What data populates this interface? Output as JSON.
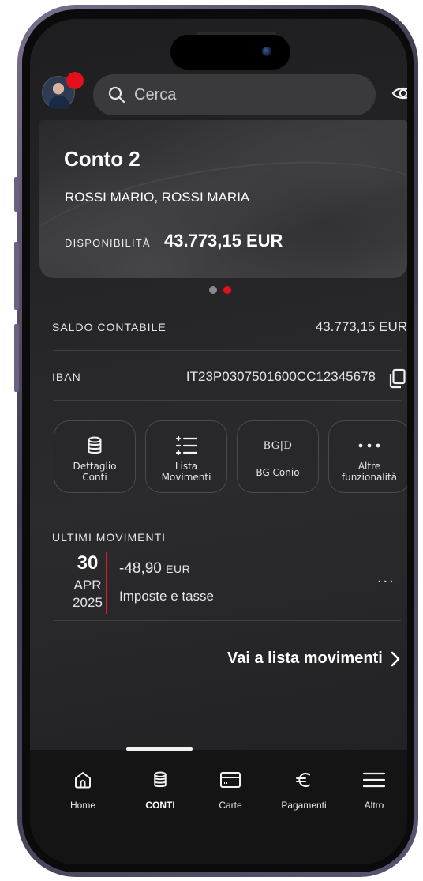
{
  "search": {
    "placeholder": "Cerca"
  },
  "account_card": {
    "name": "Conto 2",
    "holders": "ROSSI MARIO, ROSSI MARIA",
    "availability_label": "DISPONIBILITÀ",
    "availability_value": "43.773,15 EUR"
  },
  "pager": {
    "count": 2,
    "active_index": 1
  },
  "info": {
    "saldo_label": "SALDO CONTABILE",
    "saldo_value": "43.773,15 EUR",
    "iban_label": "IBAN",
    "iban_value": "IT23P0307501600CC12345678"
  },
  "actions": [
    {
      "icon": "database-icon",
      "label": "Dettaglio\nConti"
    },
    {
      "icon": "list-icon",
      "label": "Lista\nMovimenti"
    },
    {
      "icon": "bg-conio-icon",
      "icon_text": "BG|D",
      "label": "BG Conio"
    },
    {
      "icon": "more-dots-icon",
      "label": "Altre\nfunzionalità"
    }
  ],
  "movements": {
    "title": "ULTIMI MOVIMENTI",
    "items": [
      {
        "day": "30",
        "month": "APR",
        "year": "2025",
        "amount": "-48,90",
        "currency": "EUR",
        "description": "Imposte e tasse"
      }
    ],
    "more_label": "...",
    "link_label": "Vai a lista movimenti"
  },
  "tabbar": {
    "active": "CONTI",
    "items": [
      {
        "icon": "home-icon",
        "label": "Home"
      },
      {
        "icon": "database-icon",
        "label": "CONTI"
      },
      {
        "icon": "card-icon",
        "label": "Carte"
      },
      {
        "icon": "euro-icon",
        "label": "Pagamenti"
      },
      {
        "icon": "menu-icon",
        "label": "Altro"
      }
    ]
  },
  "colors": {
    "accent": "#e3101c",
    "background": "#252527",
    "text": "#e6e6e8",
    "tabbar": "#141415"
  }
}
